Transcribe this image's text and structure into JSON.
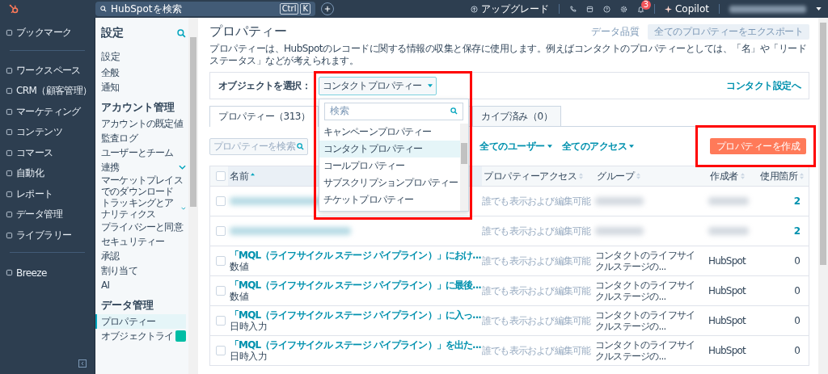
{
  "topbar": {
    "search_placeholder": "HubSpotを検索",
    "shortcut_keys": [
      "Ctrl",
      "K"
    ],
    "upgrade": "アップグレード",
    "notification_count": "3",
    "copilot": "Copilot"
  },
  "nav": {
    "groups": [
      [
        {
          "label": "ブックマーク"
        }
      ],
      [
        {
          "label": "ワークスペース"
        },
        {
          "label": "CRM（顧客管理）"
        },
        {
          "label": "マーケティング"
        },
        {
          "label": "コンテンツ"
        },
        {
          "label": "コマース"
        },
        {
          "label": "自動化"
        },
        {
          "label": "レポート"
        },
        {
          "label": "データ管理"
        },
        {
          "label": "ライブラリー"
        }
      ],
      [
        {
          "label": "Breeze"
        }
      ]
    ]
  },
  "settings": {
    "title": "設定",
    "sections": [
      {
        "heading": "設定",
        "kind": "plain",
        "items": [
          {
            "label": "全般",
            "expandable": false,
            "selected": false,
            "new_badge": false
          },
          {
            "label": "通知",
            "expandable": false,
            "selected": false,
            "new_badge": false
          }
        ]
      },
      {
        "heading": "アカウント管理",
        "kind": "bold",
        "items": [
          {
            "label": "アカウントの既定値",
            "expandable": false,
            "selected": false,
            "new_badge": false
          },
          {
            "label": "監査ログ",
            "expandable": false,
            "selected": false,
            "new_badge": false
          },
          {
            "label": "ユーザーとチーム",
            "expandable": false,
            "selected": false,
            "new_badge": false
          },
          {
            "label": "連携",
            "expandable": true,
            "selected": false,
            "new_badge": false
          },
          {
            "label": "マーケットプレイスでのダウンロード",
            "expandable": false,
            "selected": false,
            "new_badge": false
          },
          {
            "label": "トラッキングとアナリティクス",
            "expandable": true,
            "selected": false,
            "new_badge": false
          },
          {
            "label": "プライバシーと同意",
            "expandable": false,
            "selected": false,
            "new_badge": false
          },
          {
            "label": "セキュリティー",
            "expandable": false,
            "selected": false,
            "new_badge": false
          },
          {
            "label": "承認",
            "expandable": false,
            "selected": false,
            "new_badge": false
          },
          {
            "label": "割り当て",
            "expandable": false,
            "selected": false,
            "new_badge": false
          },
          {
            "label": "AI",
            "expandable": false,
            "selected": false,
            "new_badge": false
          }
        ]
      },
      {
        "heading": "データ管理",
        "kind": "bold",
        "items": [
          {
            "label": "プロパティー",
            "expandable": false,
            "selected": true,
            "new_badge": false
          },
          {
            "label": "オブジェクトライ",
            "expandable": false,
            "selected": false,
            "new_badge": true
          }
        ]
      }
    ]
  },
  "page": {
    "title": "プロパティー",
    "data_quality_link": "データ品質",
    "export_button": {
      "label": "全てのプロパティーをエクスポート",
      "disabled": true
    },
    "description": "プロパティーは、HubSpotのレコードに関する情報の収集と保存に使用します。例えばコンタクトのプロパティーとしては、「名」や「リードステータス」などが考えられます。",
    "object_select": {
      "label": "オブジェクトを選択：",
      "value": "コンタクトプロパティー",
      "expanded": true
    },
    "contact_settings_link": "コンタクト設定へ",
    "dropdown": {
      "search_placeholder": "検索",
      "options": [
        {
          "label": "キャンペーンプロパティー",
          "selected": false
        },
        {
          "label": "コンタクトプロパティー",
          "selected": true
        },
        {
          "label": "コールプロパティー",
          "selected": false
        },
        {
          "label": "サブスクリプションプロパティー",
          "selected": false
        },
        {
          "label": "チケットプロパティー",
          "selected": false
        }
      ]
    },
    "tabs": [
      {
        "label": "プロパティー（313）",
        "selected": true
      },
      {
        "label": "カイブ済み（0）",
        "selected": false
      }
    ],
    "filters": {
      "search_placeholder": "プロパティーを検索",
      "items": [
        "全てのユーザー",
        "全てのアクセス"
      ]
    },
    "create_button": "プロパティーを作成",
    "table": {
      "all_checked": false,
      "columns": [
        {
          "label": "名前",
          "sorted": true
        },
        {
          "label": "プロパティーアクセス",
          "sorted": false
        },
        {
          "label": "グループ",
          "sorted": false
        },
        {
          "label": "作成者",
          "sorted": false
        },
        {
          "label": "使用箇所",
          "sorted": false
        }
      ],
      "rows": [
        {
          "checked": false,
          "blurred": true,
          "access": "誰でも表示および編集可能",
          "usage": "2",
          "linked": true
        },
        {
          "checked": false,
          "blurred": true,
          "access": "誰でも表示および編集可能",
          "usage": "2",
          "linked": true
        },
        {
          "checked": false,
          "blurred": false,
          "name": "「MQL（ライフサイクル ステージ パイプライン）」におけ...",
          "type": "数値",
          "access": "誰でも表示および編集可能",
          "group": "コンタクトのライフサイクルステージの...",
          "author": "HubSpot",
          "usage": "0",
          "linked": false
        },
        {
          "checked": false,
          "blurred": false,
          "name": "「MQL（ライフサイクル ステージ パイプライン）」に最後...",
          "type": "数値",
          "access": "誰でも表示および編集可能",
          "group": "コンタクトのライフサイクルステージの...",
          "author": "HubSpot",
          "usage": "0",
          "linked": false
        },
        {
          "checked": false,
          "blurred": false,
          "name": "「MQL（ライフサイクル ステージ パイプライン）」に入っ...",
          "type": "日時入力",
          "access": "誰でも表示および編集可能",
          "group": "コンタクトのライフサイクルステージの...",
          "author": "HubSpot",
          "usage": "0",
          "linked": false
        },
        {
          "checked": false,
          "blurred": false,
          "name": "「MQL（ライフサイクル ステージ パイプライン）」を出た...",
          "type": "日時入力",
          "access": "誰でも表示および編集可能",
          "group": "コンタクトのライフサイクルステージの...",
          "author": "HubSpot",
          "usage": "0",
          "linked": false
        }
      ]
    }
  }
}
